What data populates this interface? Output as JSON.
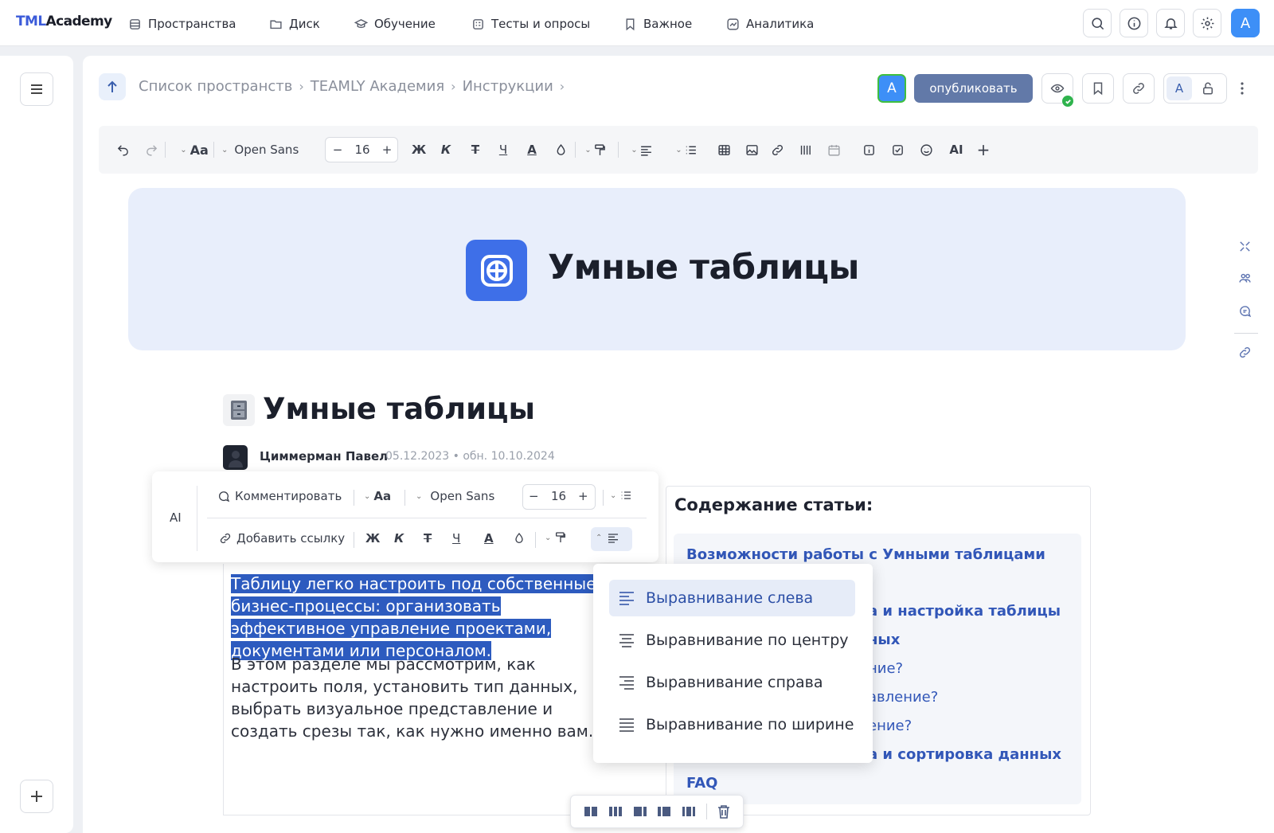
{
  "app": {
    "logo_prefix": "TML",
    "logo_suffix": "Academy"
  },
  "topnav": {
    "items": [
      {
        "label": "Пространства",
        "icon": "spaces-icon"
      },
      {
        "label": "Диск",
        "icon": "folder-icon"
      },
      {
        "label": "Обучение",
        "icon": "graduation-icon"
      },
      {
        "label": "Тесты и опросы",
        "icon": "quiz-icon"
      },
      {
        "label": "Важное",
        "icon": "bookmark-icon"
      },
      {
        "label": "Аналитика",
        "icon": "analytics-icon"
      }
    ],
    "user_initial": "A"
  },
  "breadcrumb": [
    "Список пространств",
    "TEAMLY Академия",
    "Инструкции"
  ],
  "header": {
    "editor_initial": "A",
    "publish_label": "опубликовать",
    "lang_badge": "A"
  },
  "toolbar": {
    "font_family": "Open Sans",
    "font_size": "16",
    "bold": "Ж",
    "italic": "К",
    "strike": "Т",
    "underline": "Ч",
    "text_color": "A",
    "ai": "AI",
    "aa": "Aa"
  },
  "hero": {
    "title": "Умные таблицы"
  },
  "article": {
    "title": "Умные таблицы",
    "author": "Циммерман Павел",
    "meta": "05.12.2023 • обн. 10.10.2024",
    "selected_text": "Таблицу легко настроить под собственные бизнес-процессы: организовать эффективное управление проектами, документами или персоналом.",
    "body_text": "В этом разделе мы рассмотрим, как настроить поля, установить тип данных, выбрать визуальное представление и создать срезы так, как нужно именно вам."
  },
  "floating_toolbar": {
    "ai": "AI",
    "comment": "Комментировать",
    "add_link": "Добавить ссылку",
    "font_family": "Open Sans",
    "font_size": "16",
    "aa": "Aa",
    "bold": "Ж",
    "italic": "К",
    "strike": "Т",
    "underline": "Ч",
    "text_color": "A"
  },
  "align_menu": {
    "items": [
      "Выравнивание слева",
      "Выравнивание по центру",
      "Выравнивание справа",
      "Выравнивание по ширине"
    ],
    "selected": "Выравнивание слева"
  },
  "toc": {
    "title": "Содержание статьи:",
    "links": [
      "Возможности работы с Умными таблицами",
      "ı",
      "а и настройка таблицы",
      "ных",
      "ние?",
      "авление?",
      "ение?",
      "а и сортировка данных",
      "FAQ"
    ]
  }
}
